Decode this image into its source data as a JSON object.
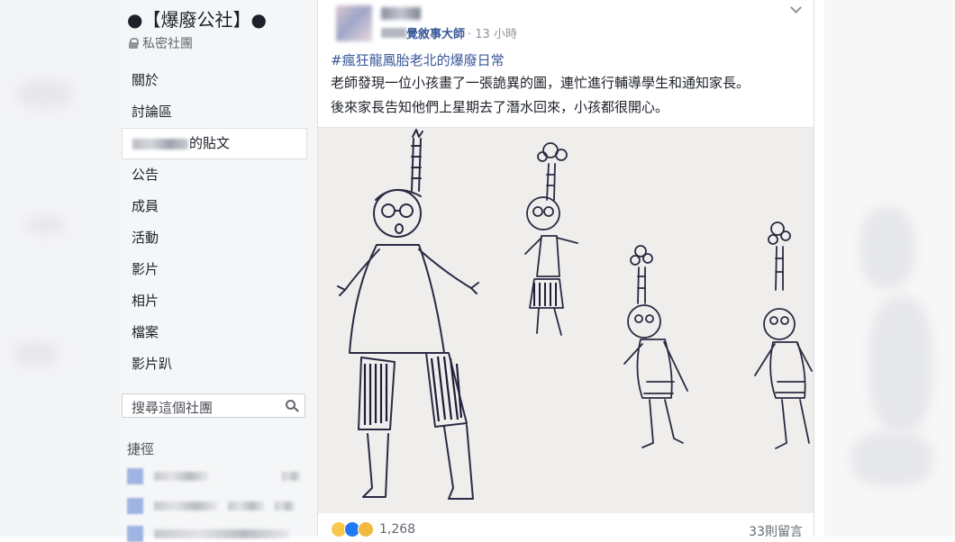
{
  "group": {
    "title": "●【爆廢公社】●",
    "privacy": "私密社團"
  },
  "sidebar": {
    "items": [
      {
        "label": "關於"
      },
      {
        "label": "討論區"
      },
      {
        "label": "的貼文"
      },
      {
        "label": "公告"
      },
      {
        "label": "成員"
      },
      {
        "label": "活動"
      },
      {
        "label": "影片"
      },
      {
        "label": "相片"
      },
      {
        "label": "檔案"
      },
      {
        "label": "影片趴"
      }
    ],
    "search_placeholder": "搜尋這個社團",
    "shortcuts_title": "捷徑"
  },
  "post": {
    "source": "覺敘事大師",
    "time": "· 13 小時",
    "hashtag": "#瘋狂龍鳳胎老北的爆廢日常",
    "line1": "老師發現一位小孩畫了一張詭異的圖，連忙進行輔導學生和通知家長。",
    "line2": "後來家長告知他們上星期去了潛水回來，小孩都很開心。",
    "reaction_count": "1,268",
    "comment_count": "33則留言"
  },
  "icons": [
    "lock-icon",
    "search-icon",
    "chevron-down-icon",
    "haha-icon",
    "like-icon",
    "wow-icon"
  ],
  "colors": {
    "link": "#385898",
    "sidebar_bg": "#f5f6f7",
    "text": "#1d2129"
  }
}
